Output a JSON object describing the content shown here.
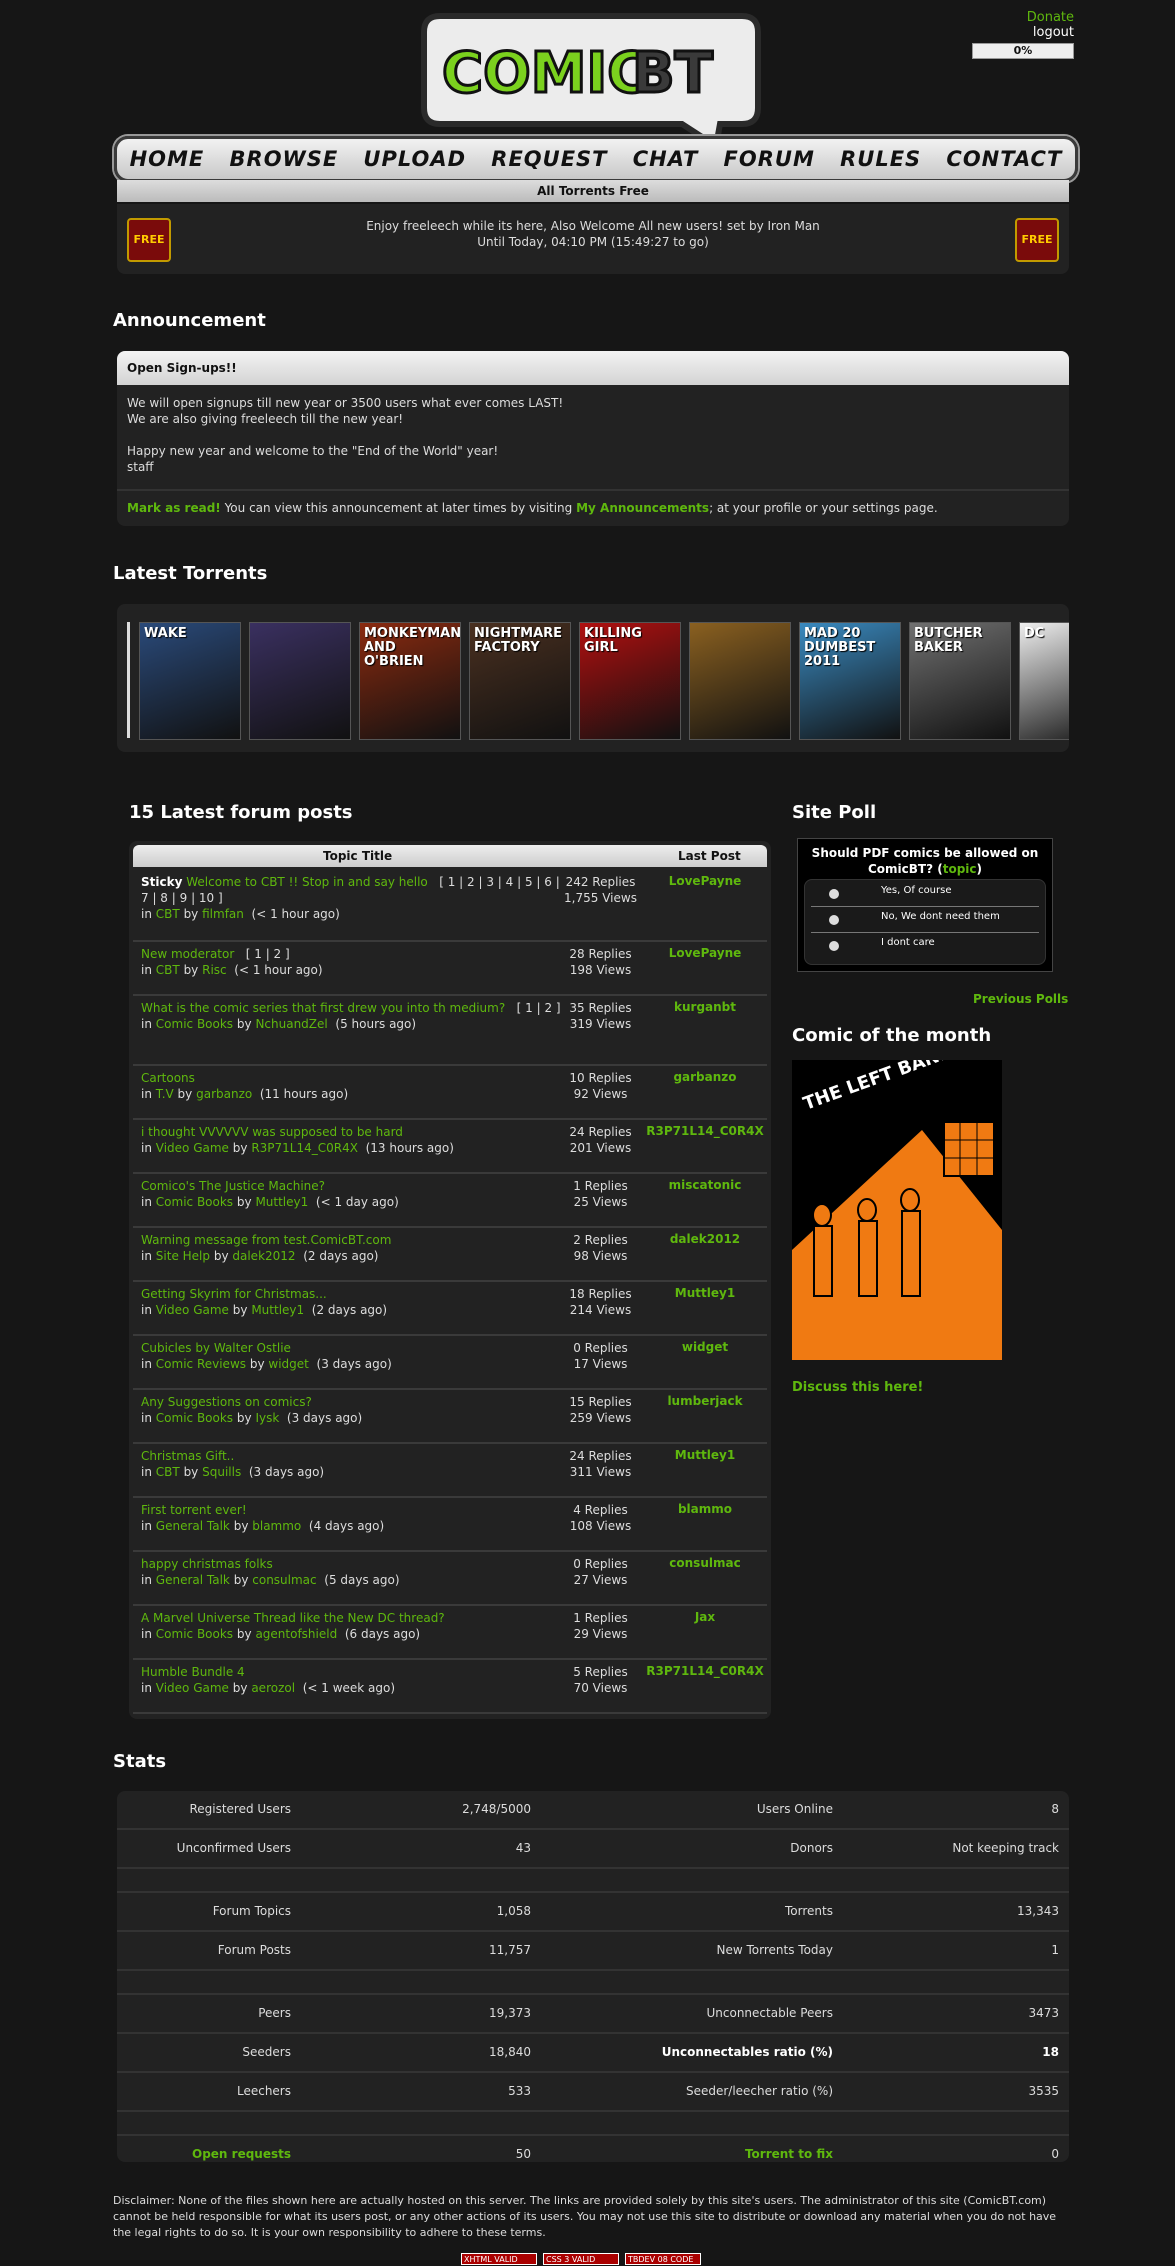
{
  "logo": {
    "text": "COMIC",
    "text2": "BT"
  },
  "user": {
    "donate": "Donate",
    "logout": "logout",
    "ratio_bar": "0%"
  },
  "nav": [
    "HOME",
    "BROWSE",
    "UPLOAD",
    "REQUEST",
    "CHAT",
    "FORUM",
    "RULES",
    "CONTACT"
  ],
  "freeleech": {
    "banner": "All Torrents Free",
    "line1": "Enjoy freeleech while its here, Also Welcome All new users! set by Iron Man",
    "line2": "Until Today, 04:10 PM (15:49:27 to go)",
    "icon": "FREE"
  },
  "announcement": {
    "heading": "Announcement",
    "title": "Open Sign-ups!!",
    "body1": "We will open signups till new year or 3500 users what ever comes LAST!",
    "body2": "We are also giving freeleech till the new year!",
    "body3": "Happy new year and welcome to the \"End of the World\" year!",
    "body4": "staff",
    "mark_read": "Mark as read!",
    "footer_mid": " You can view this announcement at later times by visiting ",
    "my_ann": "My Announcements",
    "footer_end": "; at your profile or your settings page."
  },
  "latest": {
    "heading": "Latest Torrents",
    "covers": [
      {
        "label": "WAKE",
        "color": "#2a4a7a"
      },
      {
        "label": "",
        "color": "#3a3060"
      },
      {
        "label": "MONKEYMAN AND O'BRIEN",
        "color": "#8a2a10"
      },
      {
        "label": "NIGHTMARE FACTORY",
        "color": "#4a3020"
      },
      {
        "label": "KILLING GIRL",
        "color": "#b01010"
      },
      {
        "label": "",
        "color": "#8a6020"
      },
      {
        "label": "MAD 20 DUMBEST 2011",
        "color": "#3a8ac0"
      },
      {
        "label": "BUTCHER BAKER",
        "color": "#707070"
      },
      {
        "label": "DC",
        "color": "#eeeeee"
      }
    ]
  },
  "forum": {
    "heading": "15 Latest forum posts",
    "col_title": "Topic Title",
    "col_last": "Last Post",
    "posts": [
      {
        "sticky": "Sticky",
        "title": "Welcome to CBT !! Stop in and say hello",
        "pages": "[ 1 | 2 | 3 | 4 | 5 | 6 | 7 | 8 | 9 | 10 ]",
        "in": "in",
        "forum": "CBT",
        "by": "by",
        "user": "filmfan",
        "age": "(< 1 hour ago)",
        "replies": "242 Replies",
        "views": "1,755 Views",
        "last": "LovePayne"
      },
      {
        "title": "New moderator",
        "pages": "[ 1 | 2 ]",
        "in": "in",
        "forum": "CBT",
        "by": "by",
        "user": "Risc",
        "age": "(< 1 hour ago)",
        "replies": "28 Replies",
        "views": "198 Views",
        "last": "LovePayne"
      },
      {
        "title": "What is the comic series that first drew you into th medium?",
        "pages": "[ 1 | 2 ]",
        "in": "in",
        "forum": "Comic Books",
        "by": "by",
        "user": "NchuandZel",
        "age": "(5 hours ago)",
        "replies": "35 Replies",
        "views": "319 Views",
        "last": "kurganbt"
      },
      {
        "title": "Cartoons",
        "in": "in",
        "forum": "T.V",
        "by": "by",
        "user": "garbanzo",
        "age": "(11 hours ago)",
        "replies": "10 Replies",
        "views": "92 Views",
        "last": "garbanzo"
      },
      {
        "title": "i thought VVVVVV was supposed to be hard",
        "in": "in",
        "forum": "Video Game",
        "by": "by",
        "user": "R3P71L14_C0R4X",
        "age": "(13 hours ago)",
        "replies": "24 Replies",
        "views": "201 Views",
        "last": "R3P71L14_C0R4X"
      },
      {
        "title": "Comico's The Justice Machine?",
        "in": "in",
        "forum": "Comic Books",
        "by": "by",
        "user": "Muttley1",
        "age": "(< 1 day ago)",
        "replies": "1 Replies",
        "views": "25 Views",
        "last": "miscatonic"
      },
      {
        "title": "Warning message from test.ComicBT.com",
        "in": "in",
        "forum": "Site Help",
        "by": "by",
        "user": "dalek2012",
        "age": "(2 days ago)",
        "replies": "2 Replies",
        "views": "98 Views",
        "last": "dalek2012"
      },
      {
        "title": "Getting Skyrim for Christmas...",
        "in": "in",
        "forum": "Video Game",
        "by": "by",
        "user": "Muttley1",
        "age": "(2 days ago)",
        "replies": "18 Replies",
        "views": "214 Views",
        "last": "Muttley1"
      },
      {
        "title": "Cubicles by Walter Ostlie",
        "in": "in",
        "forum": "Comic Reviews",
        "by": "by",
        "user": "widget",
        "age": "(3 days ago)",
        "replies": "0 Replies",
        "views": "17 Views",
        "last": "widget"
      },
      {
        "title": "Any Suggestions on comics?",
        "in": "in",
        "forum": "Comic Books",
        "by": "by",
        "user": "Iysk",
        "age": "(3 days ago)",
        "replies": "15 Replies",
        "views": "259 Views",
        "last": "lumberjack"
      },
      {
        "title": "Christmas Gift..",
        "in": "in",
        "forum": "CBT",
        "by": "by",
        "user": "Squills",
        "age": "(3 days ago)",
        "replies": "24 Replies",
        "views": "311 Views",
        "last": "Muttley1"
      },
      {
        "title": "First torrent ever!",
        "in": "in",
        "forum": "General Talk",
        "by": "by",
        "user": "blammo",
        "age": "(4 days ago)",
        "replies": "4 Replies",
        "views": "108 Views",
        "last": "blammo"
      },
      {
        "title": "happy christmas folks",
        "in": "in",
        "forum": "General Talk",
        "by": "by",
        "user": "consulmac",
        "age": "(5 days ago)",
        "replies": "0 Replies",
        "views": "27 Views",
        "last": "consulmac"
      },
      {
        "title": "A Marvel Universe Thread like the New DC thread?",
        "in": "in",
        "forum": "Comic Books",
        "by": "by",
        "user": "agentofshield",
        "age": "(6 days ago)",
        "replies": "1 Replies",
        "views": "29 Views",
        "last": "Jax"
      },
      {
        "title": "Humble Bundle 4",
        "in": "in",
        "forum": "Video Game",
        "by": "by",
        "user": "aerozol",
        "age": "(< 1 week ago)",
        "replies": "5 Replies",
        "views": "70 Views",
        "last": "R3P71L14_C0R4X"
      }
    ]
  },
  "poll": {
    "heading": "Site Poll",
    "question": "Should PDF comics be allowed on ComicBT?",
    "topic_pre": "(",
    "topic": "topic",
    "topic_post": ")",
    "options": [
      "Yes, Of course",
      "No, We dont need them",
      "I dont care"
    ],
    "previous": "Previous Polls"
  },
  "comic_month": {
    "heading": "Comic of the month",
    "cover_title": "THE LEFT BANK GANG",
    "discuss": "Discuss this here!"
  },
  "stats": {
    "heading": "Stats",
    "rows": [
      [
        "Registered Users",
        "2,748/5000",
        "Users Online",
        "8"
      ],
      [
        "Unconfirmed Users",
        "43",
        "Donors",
        "Not keeping track"
      ],
      [
        "",
        "",
        "",
        ""
      ],
      [
        "Forum Topics",
        "1,058",
        "Torrents",
        "13,343"
      ],
      [
        "Forum Posts",
        "11,757",
        "New Torrents Today",
        "1"
      ],
      [
        "",
        "",
        "",
        ""
      ],
      [
        "Peers",
        "19,373",
        "Unconnectable Peers",
        "3473"
      ],
      [
        "Seeders",
        "18,840",
        "Unconnectables ratio (%)",
        "18"
      ],
      [
        "Leechers",
        "533",
        "Seeder/leecher ratio (%)",
        "3535"
      ],
      [
        "",
        "",
        "",
        ""
      ],
      [
        "Open requests",
        "50",
        "Torrent to fix",
        "0"
      ]
    ]
  },
  "disclaimer": "Disclaimer: None of the files shown here are actually hosted on this server. The links are provided solely by this site's users. The administrator of this site (ComicBT.com) cannot be held responsible for what its users post, or any other actions of its users. You may not use this site to distribute or download any material when you do not have the legal rights to do so. It is your own responsibility to adhere to these terms.",
  "badges": [
    "XHTML VALID",
    "CSS 3 VALID",
    "TBDEV 08 CODE"
  ]
}
